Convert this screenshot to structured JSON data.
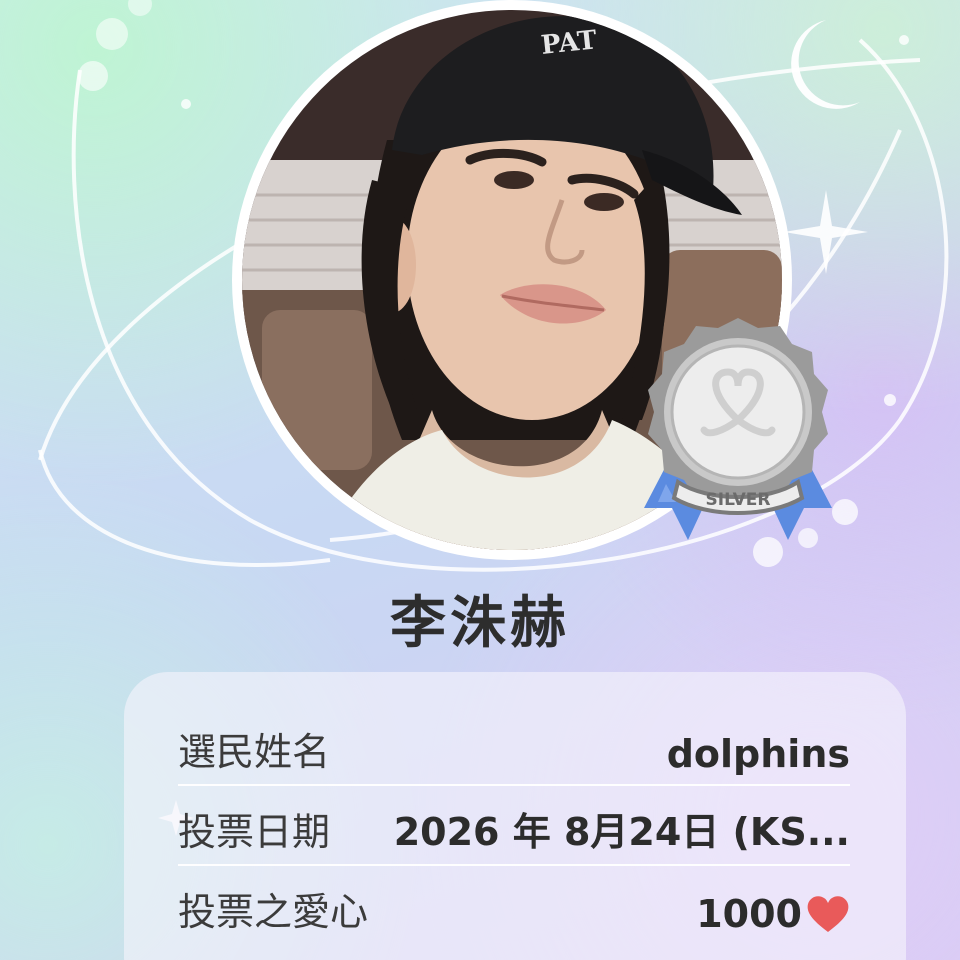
{
  "profile": {
    "name": "李洙赫",
    "photo_alt": "profile photo",
    "badge_label": "SILVER"
  },
  "vote_info": {
    "voter_name_label": "選民姓名",
    "voter_name_value": "dolphins",
    "vote_date_label": "投票日期",
    "vote_date_value": "2026 年 8月24日 (KS...",
    "hearts_label": "投票之愛心",
    "hearts_value": "1000"
  },
  "icons": {
    "heart": "heart-icon",
    "moon": "crescent-moon-icon",
    "sparkle": "sparkle-icon",
    "medal": "silver-medal-icon"
  },
  "colors": {
    "heart": "#e95a5a",
    "ribbon": "#5b8be0",
    "medal": "#bdbdbd",
    "text": "#2c2c2c"
  }
}
